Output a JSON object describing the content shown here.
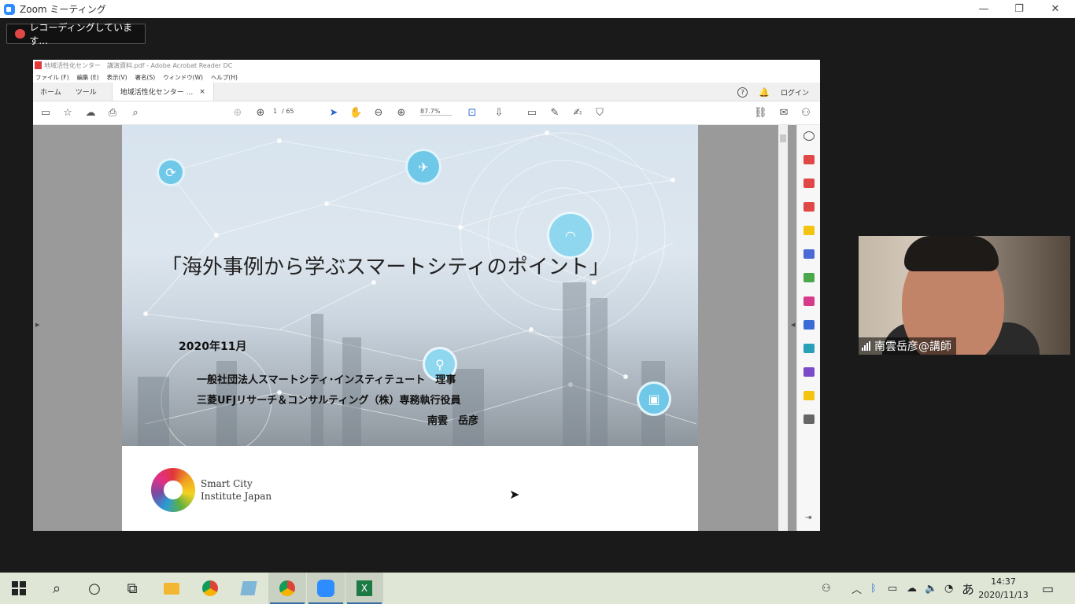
{
  "zoom": {
    "title": "Zoom ミーティング",
    "recording_label": "レコーディングしています...",
    "participant_name": "南雲岳彦@講師"
  },
  "acrobat": {
    "window_title": "地域活性化センター　講演資料.pdf - Adobe Acrobat Reader DC",
    "menu": [
      "ファイル (F)",
      "編集 (E)",
      "表示(V)",
      "署名(S)",
      "ウィンドウ(W)",
      "ヘルプ(H)"
    ],
    "tabs": {
      "home": "ホーム",
      "tools": "ツール",
      "document": "地域活性化センター ..."
    },
    "login": "ログイン",
    "page_current": "1",
    "page_total": "/ 65",
    "zoom_level": "87.7%"
  },
  "slide": {
    "title": "「海外事例から学ぶスマートシティのポイント」",
    "date": "2020年11月",
    "line1": "一般社団法人スマートシティ･インスティテュート　理事",
    "line2": "三菱UFJリサーチ＆コンサルティング（株）専務執行役員",
    "line3": "南雲　岳彦",
    "logo_line1": "Smart City",
    "logo_line2": "Institute Japan"
  },
  "taskbar": {
    "time": "14:37",
    "date": "2020/11/13",
    "ime": "あ"
  },
  "colors": {
    "zoom_blue": "#2d8cff",
    "acrobat_red": "#e03a3a",
    "taskbar": "#dfe6d6"
  }
}
